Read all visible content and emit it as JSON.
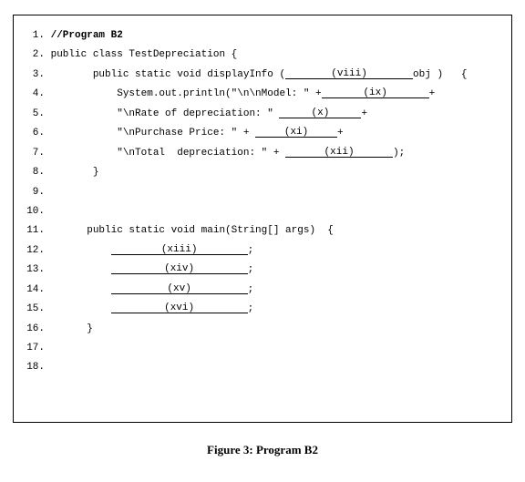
{
  "lines": {
    "l1_comment": "//Program B2",
    "l2": "public class TestDepreciation {",
    "l3_a": "public static void displayInfo (",
    "l3_blank": "(viii)",
    "l3_b": "obj )   {",
    "l4_a": "System.out.println(\"\\n\\nModel: \" +",
    "l4_blank": "(ix)",
    "l4_b": "+",
    "l5_a": "\"\\nRate of depreciation: \" ",
    "l5_blank": "(x)",
    "l5_b": "+",
    "l6_a": "\"\\nPurchase Price: \" + ",
    "l6_blank": "(xi)",
    "l6_b": "+",
    "l7_a": "\"\\nTotal  depreciation: \" + ",
    "l7_blank": "(xii)",
    "l7_b": ");",
    "l8": "}",
    "l11": "public static void main(String[] args)  {",
    "l12_blank": "(xiii)",
    "l13_blank": "(xiv)",
    "l14_blank": "(xv)",
    "l15_blank": "(xvi)",
    "semi": ";",
    "l16": "}"
  },
  "nums": {
    "n1": "1.",
    "n2": "2.",
    "n3": "3.",
    "n4": "4.",
    "n5": "5.",
    "n6": "6.",
    "n7": "7.",
    "n8": "8.",
    "n9": "9.",
    "n10": "10.",
    "n11": "11.",
    "n12": "12.",
    "n13": "13.",
    "n14": "14.",
    "n15": "15.",
    "n16": "16.",
    "n17": "17.",
    "n18": "18."
  },
  "caption": "Figure 3: Program B2"
}
